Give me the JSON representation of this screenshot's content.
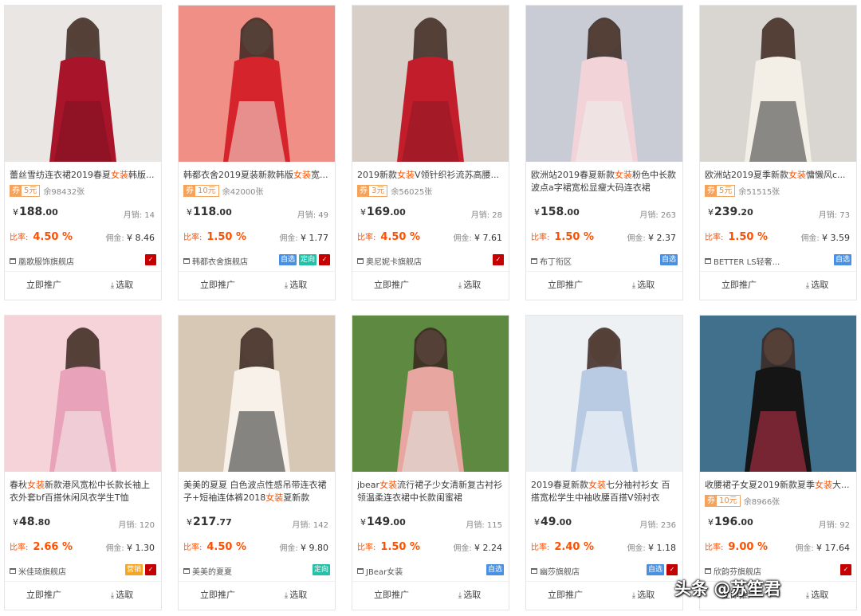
{
  "products": [
    {
      "title_pre": "蕾丝雪纺连衣裙2019春夏",
      "title_hl": "女装",
      "title_post": "韩版...",
      "coupon_label": "券",
      "coupon_value": "5元",
      "coupon_rest": "余98432张",
      "price_sym": "¥",
      "price_int": "188",
      "price_dec": ".00",
      "sales": "月销: 14",
      "rate_label": "比率:",
      "rate": "4.50 %",
      "comm_label": "佣金:",
      "comm": "¥ 8.46",
      "shop": "凰歌服饰旗舰店",
      "badges": [
        {
          "t": "✓",
          "c": "tm"
        }
      ]
    },
    {
      "title_pre": "韩都衣舍2019夏装新款韩版",
      "title_hl": "女装",
      "title_post": "宽...",
      "coupon_label": "券",
      "coupon_value": "10元",
      "coupon_rest": "余42000张",
      "price_sym": "¥",
      "price_int": "118",
      "price_dec": ".00",
      "sales": "月销: 49",
      "rate_label": "比率:",
      "rate": "1.50 %",
      "comm_label": "佣金:",
      "comm": "¥ 1.77",
      "shop": "韩都衣舍旗舰店",
      "badges": [
        {
          "t": "自选",
          "c": "blue"
        },
        {
          "t": "定向",
          "c": "green"
        },
        {
          "t": "✓",
          "c": "tm"
        }
      ]
    },
    {
      "title_pre": "2019新款",
      "title_hl": "女装",
      "title_post": "V领针织衫流苏高腰...",
      "coupon_label": "券",
      "coupon_value": "3元",
      "coupon_rest": "余56025张",
      "price_sym": "¥",
      "price_int": "169",
      "price_dec": ".00",
      "sales": "月销: 28",
      "rate_label": "比率:",
      "rate": "4.50 %",
      "comm_label": "佣金:",
      "comm": "¥ 7.61",
      "shop": "奥尼妮卡旗舰店",
      "badges": [
        {
          "t": "✓",
          "c": "tm"
        }
      ]
    },
    {
      "title_pre": "欧洲站2019春夏新款",
      "title_hl": "女装",
      "title_post": "粉色中长款 波点a字裙宽松显瘦大码连衣裙",
      "coupon_label": "",
      "coupon_value": "",
      "coupon_rest": "",
      "price_sym": "¥",
      "price_int": "158",
      "price_dec": ".00",
      "sales": "月销: 263",
      "rate_label": "比率:",
      "rate": "1.50 %",
      "comm_label": "佣金:",
      "comm": "¥ 2.37",
      "shop": "布丁衔区",
      "badges": [
        {
          "t": "自选",
          "c": "blue"
        }
      ]
    },
    {
      "title_pre": "欧洲站2019夏季新款",
      "title_hl": "女装",
      "title_post": "慵懒风c...",
      "coupon_label": "券",
      "coupon_value": "5元",
      "coupon_rest": "余51515张",
      "price_sym": "¥",
      "price_int": "239",
      "price_dec": ".20",
      "sales": "月销: 73",
      "rate_label": "比率:",
      "rate": "1.50 %",
      "comm_label": "佣金:",
      "comm": "¥ 3.59",
      "shop": "BETTER LS轻奢...",
      "badges": [
        {
          "t": "自选",
          "c": "blue"
        }
      ]
    },
    {
      "title_pre": "春秋",
      "title_hl": "女装",
      "title_post": "新款港风宽松中长款长袖上衣外套bf百搭休闲风衣学生T恤",
      "coupon_label": "",
      "coupon_value": "",
      "coupon_rest": "",
      "price_sym": "¥",
      "price_int": "48",
      "price_dec": ".80",
      "sales": "月销: 120",
      "rate_label": "比率:",
      "rate": "2.66 %",
      "comm_label": "佣金:",
      "comm": "¥ 1.30",
      "shop": "米佳琦旗舰店",
      "badges": [
        {
          "t": "营销",
          "c": "orange"
        },
        {
          "t": "✓",
          "c": "tm"
        }
      ]
    },
    {
      "title_pre": "美美的夏夏 白色波点性感吊带连衣裙子+短袖连体裤2018",
      "title_hl": "女装",
      "title_post": "夏新款",
      "coupon_label": "",
      "coupon_value": "",
      "coupon_rest": "",
      "price_sym": "¥",
      "price_int": "217",
      "price_dec": ".77",
      "sales": "月销: 142",
      "rate_label": "比率:",
      "rate": "4.50 %",
      "comm_label": "佣金:",
      "comm": "¥ 9.80",
      "shop": "美美的夏夏",
      "badges": [
        {
          "t": "定向",
          "c": "green"
        }
      ]
    },
    {
      "title_pre": "jbear",
      "title_hl": "女装",
      "title_post": "流行裙子少女清新复古衬衫领温柔连衣裙中长款闺蜜裙",
      "coupon_label": "",
      "coupon_value": "",
      "coupon_rest": "",
      "price_sym": "¥",
      "price_int": "149",
      "price_dec": ".00",
      "sales": "月销: 115",
      "rate_label": "比率:",
      "rate": "1.50 %",
      "comm_label": "佣金:",
      "comm": "¥ 2.24",
      "shop": "JBear女装",
      "badges": [
        {
          "t": "自选",
          "c": "blue"
        }
      ]
    },
    {
      "title_pre": "2019春夏新款",
      "title_hl": "女装",
      "title_post": "七分袖衬衫女 百搭宽松学生中袖收腰百搭V领衬衣",
      "coupon_label": "",
      "coupon_value": "",
      "coupon_rest": "",
      "price_sym": "¥",
      "price_int": "49",
      "price_dec": ".00",
      "sales": "月销: 236",
      "rate_label": "比率:",
      "rate": "2.40 %",
      "comm_label": "佣金:",
      "comm": "¥ 1.18",
      "shop": "幽莎旗舰店",
      "badges": [
        {
          "t": "自选",
          "c": "blue"
        },
        {
          "t": "✓",
          "c": "tm"
        }
      ]
    },
    {
      "title_pre": "收腰裙子女夏2019新款夏季",
      "title_hl": "女装",
      "title_post": "大...",
      "coupon_label": "券",
      "coupon_value": "10元",
      "coupon_rest": "余8966张",
      "price_sym": "¥",
      "price_int": "196",
      "price_dec": ".00",
      "sales": "月销: 92",
      "rate_label": "比率:",
      "rate": "9.00 %",
      "comm_label": "佣金:",
      "comm": "¥ 17.64",
      "shop": "欣韵芬旗舰店",
      "badges": [
        {
          "t": "✓",
          "c": "tm"
        }
      ]
    }
  ],
  "actions": {
    "promote": "立即推广",
    "select": "选取"
  },
  "watermark": "头条 @苏笙君"
}
